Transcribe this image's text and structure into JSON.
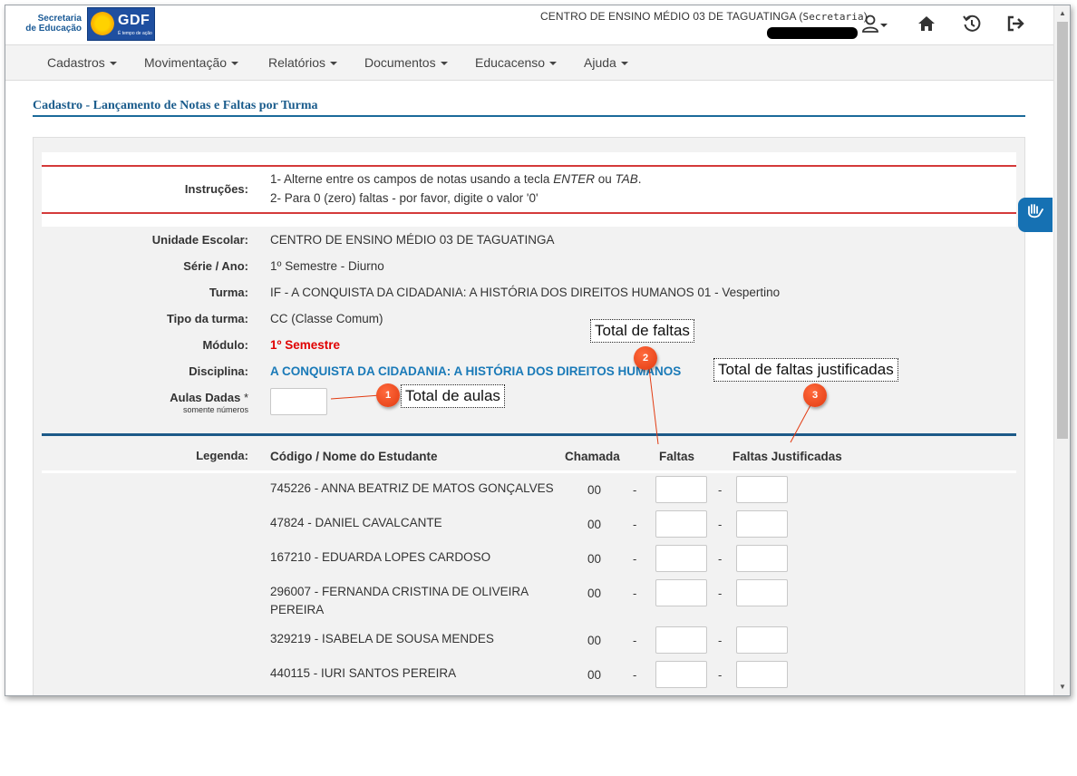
{
  "header": {
    "logo_sec_line1": "Secretaria",
    "logo_sec_line2": "de Educação",
    "logo_gdf": "GDF",
    "logo_gdf_tagline": "É tempo de ação",
    "school_name": "CENTRO DE ENSINO MÉDIO 03 DE TAGUATINGA (",
    "role": "Secretaria",
    "role_close": ")",
    "icons": [
      "user-icon",
      "home-icon",
      "history-icon",
      "logout-icon"
    ]
  },
  "nav": {
    "items": [
      "Cadastros",
      "Movimentação",
      "Relatórios",
      "Documentos",
      "Educacenso",
      "Ajuda"
    ]
  },
  "page": {
    "title": "Cadastro - Lançamento de Notas e Faltas por Turma"
  },
  "instructions": {
    "label": "Instruções:",
    "line1_pre": "1- Alterne entre os campos de notas usando a tecla ",
    "line1_key1": "ENTER",
    "line1_mid": " ou ",
    "line1_key2": "TAB",
    "line1_end": ".",
    "line2": "2- Para 0 (zero) faltas - por favor, digite o valor '0'"
  },
  "info": {
    "unidade_label": "Unidade Escolar:",
    "unidade_value": "CENTRO DE ENSINO MÉDIO 03 DE TAGUATINGA",
    "serie_label": "Série / Ano:",
    "serie_value": "1º Semestre - Diurno",
    "turma_label": "Turma:",
    "turma_value": "IF - A CONQUISTA DA CIDADANIA: A HISTÓRIA DOS DIREITOS HUMANOS 01 - Vespertino",
    "tipo_label": "Tipo da turma:",
    "tipo_value": "CC (Classe Comum)",
    "modulo_label": "Módulo:",
    "modulo_value": "1º Semestre",
    "disciplina_label": "Disciplina:",
    "disciplina_value": "A CONQUISTA DA CIDADANIA: A HISTÓRIA DOS DIREITOS HUMANOS",
    "aulas_label": "Aulas Dadas",
    "aulas_required": "*",
    "aulas_hint": "somente números",
    "aulas_value": ""
  },
  "table": {
    "legenda_label": "Legenda:",
    "col_nome": "Código / Nome do Estudante",
    "col_chamada": "Chamada",
    "col_faltas": "Faltas",
    "col_justificadas": "Faltas Justificadas",
    "dash": "-",
    "students": [
      {
        "name": "745226 - ANNA BEATRIZ DE MATOS GONÇALVES",
        "chamada": "00",
        "faltas": "",
        "justificadas": ""
      },
      {
        "name": "47824 - DANIEL CAVALCANTE",
        "chamada": "00",
        "faltas": "",
        "justificadas": ""
      },
      {
        "name": "167210 - EDUARDA LOPES CARDOSO",
        "chamada": "00",
        "faltas": "",
        "justificadas": ""
      },
      {
        "name": "296007 - FERNANDA CRISTINA DE OLIVEIRA PEREIRA",
        "chamada": "00",
        "faltas": "",
        "justificadas": ""
      },
      {
        "name": "329219 - ISABELA DE SOUSA MENDES",
        "chamada": "00",
        "faltas": "",
        "justificadas": ""
      },
      {
        "name": "440115 - IURI SANTOS PEREIRA",
        "chamada": "00",
        "faltas": "",
        "justificadas": ""
      }
    ]
  },
  "annotations": [
    {
      "number": "1",
      "text": "Total de aulas"
    },
    {
      "number": "2",
      "text": "Total de faltas"
    },
    {
      "number": "3",
      "text": "Total de faltas justificadas"
    }
  ],
  "colors": {
    "title_blue": "#1b5c8c",
    "red_rule": "#d43a3a",
    "modulo_red": "#e00000",
    "disciplina_blue": "#1a7ab8",
    "badge_orange": "#e23a10"
  }
}
